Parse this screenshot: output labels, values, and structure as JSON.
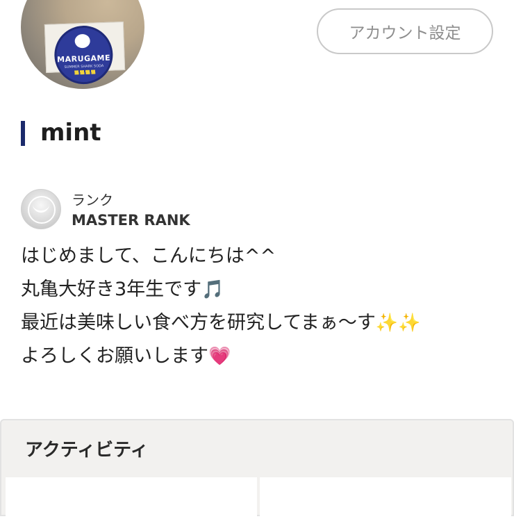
{
  "profile": {
    "avatar_sticker_text": "MARUGAME",
    "avatar_sticker_subtext": "SUMMER SHARK SODA",
    "account_button_label": "アカウント設定",
    "user_name": "mint"
  },
  "rank": {
    "label": "ランク",
    "value": "MASTER RANK",
    "badge_icon": "master-rank-badge-icon"
  },
  "bio": {
    "line1": "はじめまして、こんにちは^^",
    "line2_text": "丸亀大好き3年生です",
    "line2_emoji": "🎵",
    "line3_text": "最近は美味しい食べ方を研究してまぁ〜す",
    "line3_emoji": "✨✨",
    "line4_text": "よろしくお願いします",
    "line4_emoji": "💗"
  },
  "activity": {
    "title": "アクティビティ"
  },
  "colors": {
    "accent_bar": "#1b2a6b",
    "activity_bg": "#f2f1ef",
    "button_border": "#c9c9c9"
  }
}
